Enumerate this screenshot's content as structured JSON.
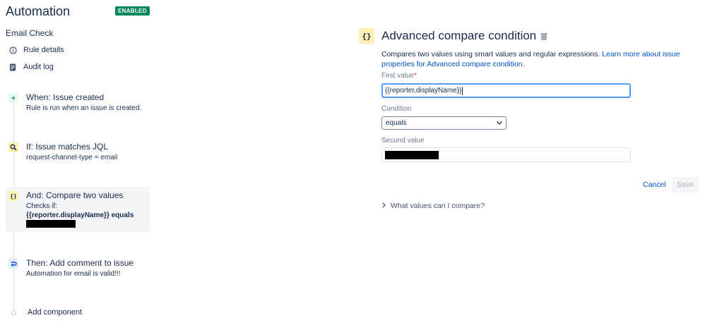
{
  "header": {
    "title": "Automation",
    "status_badge": "ENABLED",
    "rule_name": "Email Check"
  },
  "sidebar": {
    "links": [
      {
        "label": "Rule details",
        "icon": "info-icon"
      },
      {
        "label": "Audit log",
        "icon": "document-icon"
      }
    ],
    "steps": [
      {
        "icon": "plus-icon",
        "icon_glyph": "+",
        "title": "When: Issue created",
        "desc": "Rule is run when an issue is created."
      },
      {
        "icon": "search-icon",
        "icon_glyph": "⚲",
        "title": "If: Issue matches JQL",
        "desc": "request-channel-type = email"
      },
      {
        "icon": "braces-icon",
        "icon_glyph": "{}",
        "title": "And: Compare two values",
        "desc_prefix": "Checks if:",
        "desc_bold": "{{reporter.displayName}} equals"
      },
      {
        "icon": "comment-icon",
        "icon_glyph": "↻",
        "title": "Then: Add comment to issue",
        "desc": "Automation for email is valid!!!"
      }
    ],
    "add_component": "Add component"
  },
  "panel": {
    "icon_glyph": "{}",
    "title": "Advanced compare condition",
    "description": "Compares two values using smart values and regular expressions.",
    "learn_more": "Learn more about issue properties for Advanced compare condition.",
    "first_value_label": "First value",
    "required_mark": "*",
    "first_value": "{{reporter.displayName}}",
    "condition_label": "Condition",
    "condition_value": "equals",
    "second_value_label": "Second value",
    "cancel_label": "Cancel",
    "save_label": "Save",
    "disclosure_label": "What values can I compare?"
  },
  "colors": {
    "badge": "#00875a",
    "link": "#0052cc",
    "focus": "#4c9aff",
    "selected_step_bg": "#f4f5f7"
  }
}
